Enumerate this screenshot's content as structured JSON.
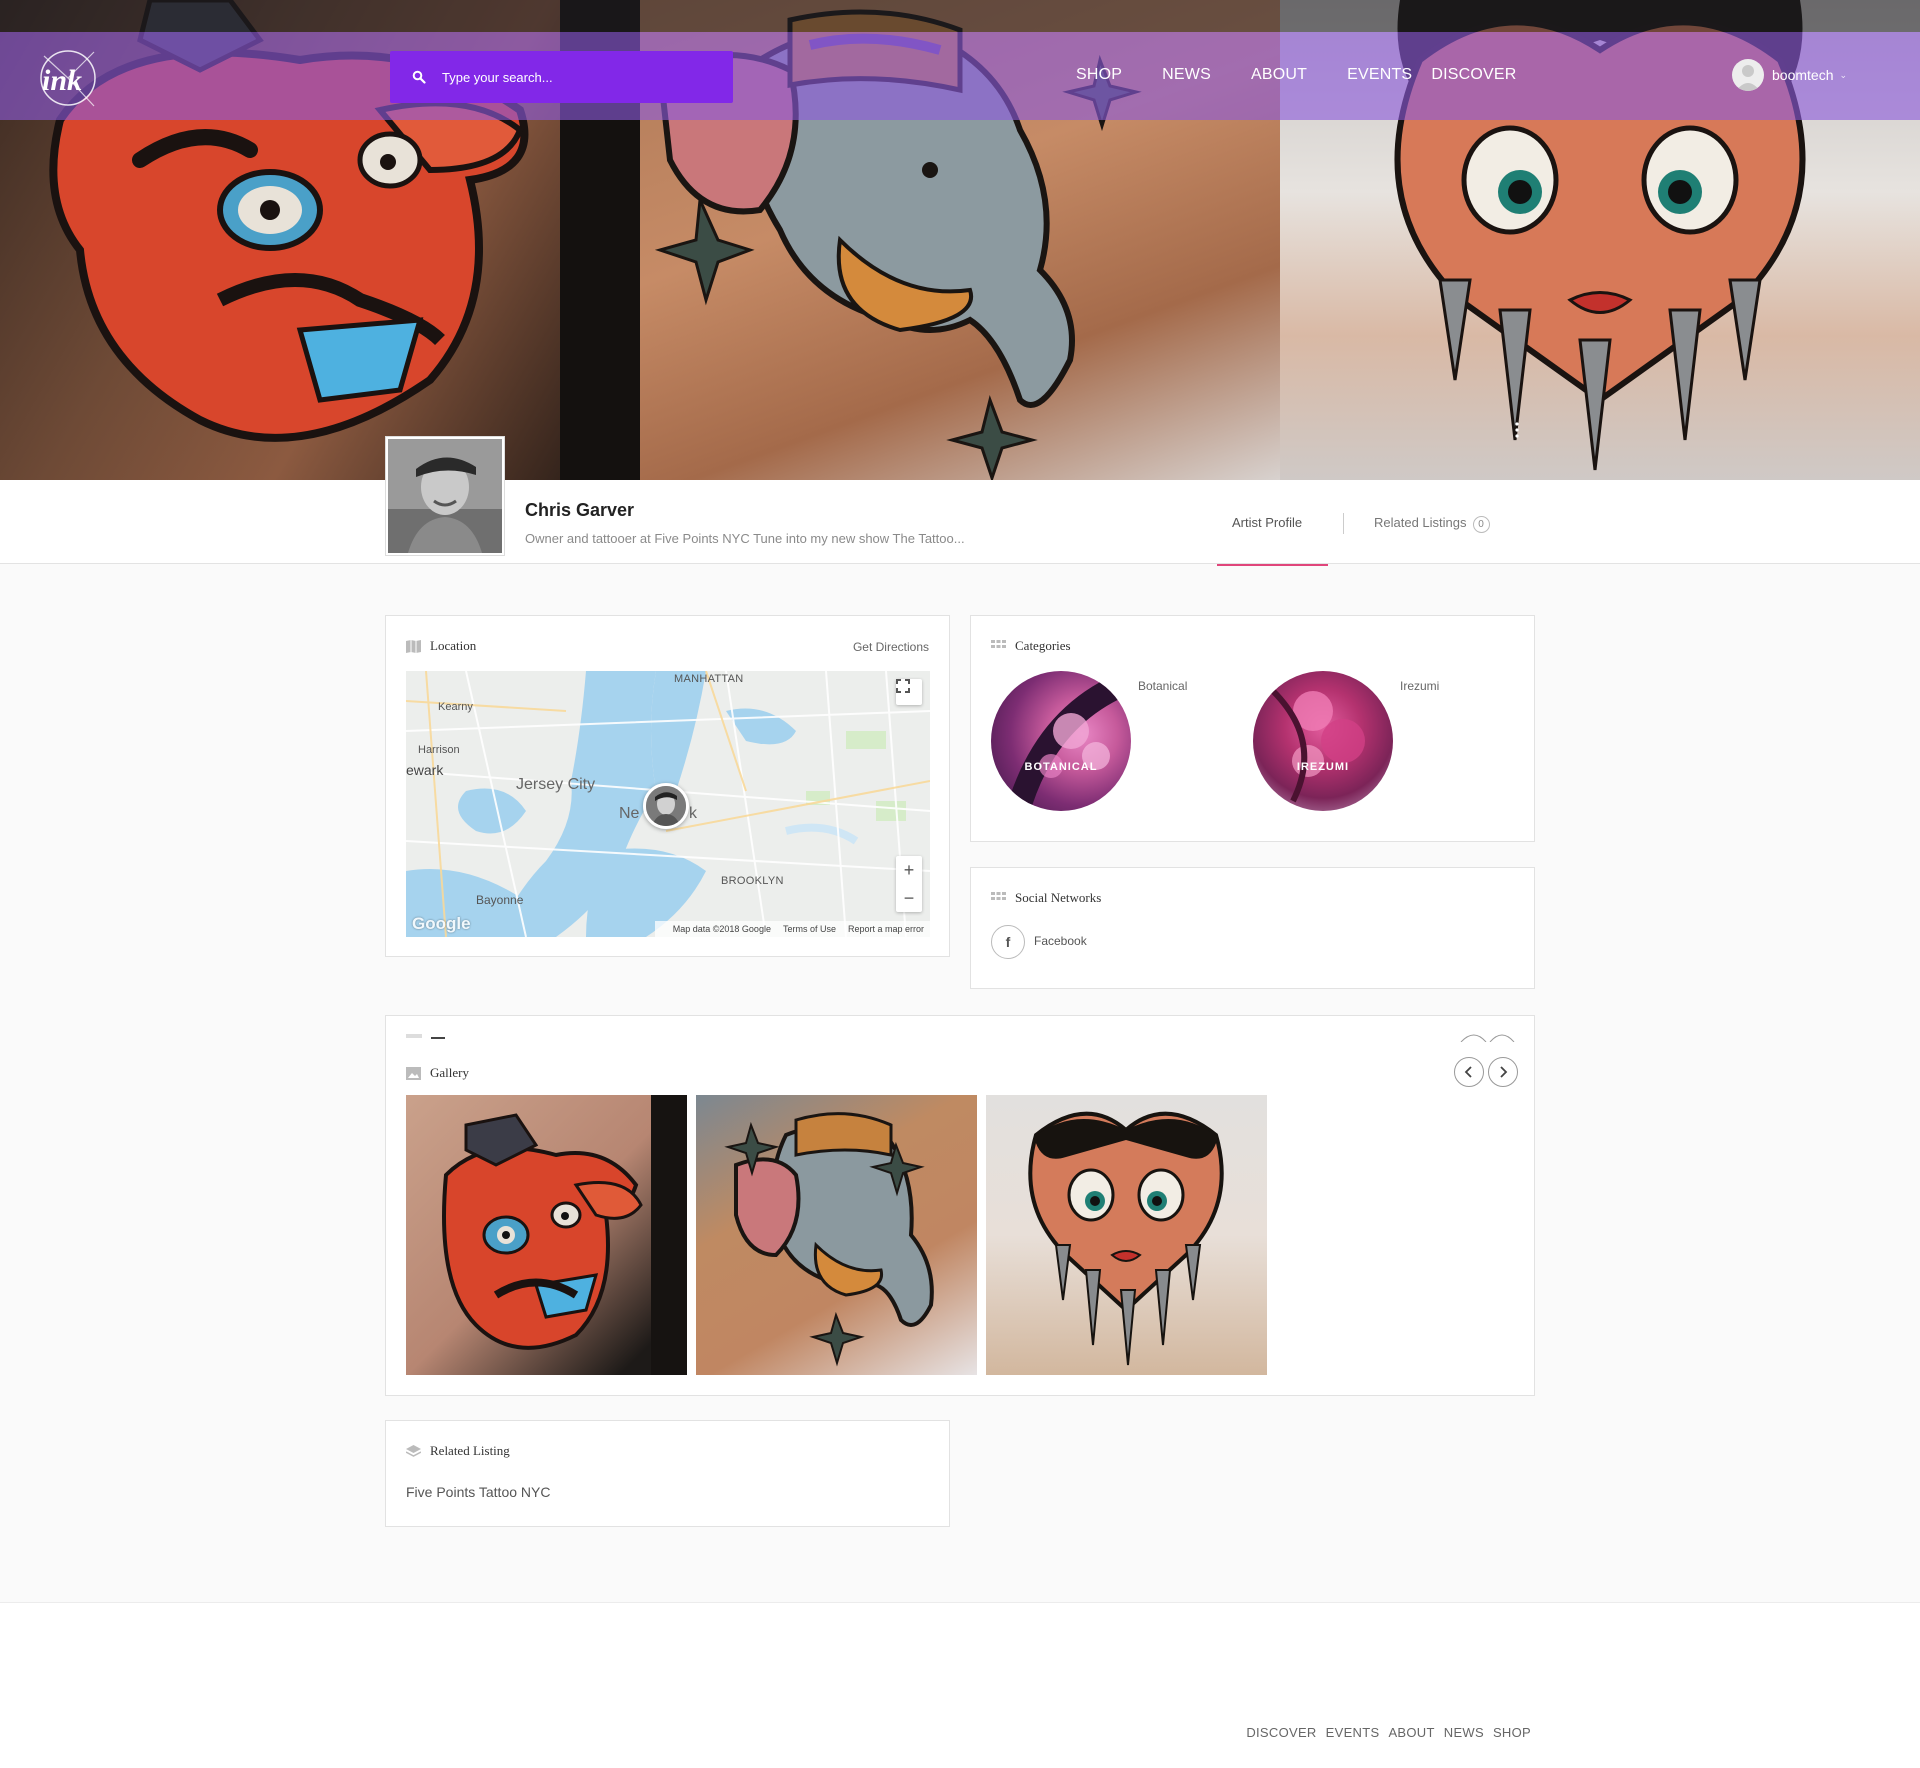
{
  "header": {
    "logo_text": "ink",
    "search": {
      "placeholder": "Type your search..."
    },
    "nav": [
      "SHOP",
      "NEWS",
      "ABOUT",
      "EVENTS",
      "DISCOVER"
    ],
    "user": {
      "name": "boomtech"
    }
  },
  "profile": {
    "name": "Chris Garver",
    "description": "Owner and tattooer at Five Points NYC Tune into my new show The Tattoo...",
    "tabs": {
      "artist_profile": "Artist Profile",
      "related_listings": "Related Listings",
      "related_count": "0"
    }
  },
  "location": {
    "title": "Location",
    "directions": "Get Directions",
    "map": {
      "labels": {
        "manhattan": "MANHATTAN",
        "kearny": "Kearny",
        "harrison": "Harrison",
        "newark": "ewark",
        "jersey_city": "Jersey City",
        "new_york": "Ne",
        "new_york_tail": "k",
        "brooklyn": "BROOKLYN",
        "bayonne": "Bayonne"
      },
      "google": "Google",
      "footer": {
        "data": "Map data ©2018 Google",
        "terms": "Terms of Use",
        "report": "Report a map error"
      },
      "zoom_in": "+",
      "zoom_out": "−"
    }
  },
  "categories": {
    "title": "Categories",
    "items": [
      {
        "name": "Botanical",
        "label": "BOTANICAL"
      },
      {
        "name": "Irezumi",
        "label": "IREZUMI"
      }
    ]
  },
  "social": {
    "title": "Social Networks",
    "items": [
      {
        "icon": "f",
        "label": "Facebook"
      }
    ]
  },
  "gallery": {
    "title": "Gallery"
  },
  "related": {
    "title": "Related Listing",
    "items": [
      "Five Points Tattoo NYC"
    ]
  },
  "footer": {
    "nav": [
      "DISCOVER",
      "EVENTS",
      "ABOUT",
      "NEWS",
      "SHOP"
    ]
  },
  "colors": {
    "accent": "#8228e8",
    "tab_underline": "#e0457b"
  }
}
